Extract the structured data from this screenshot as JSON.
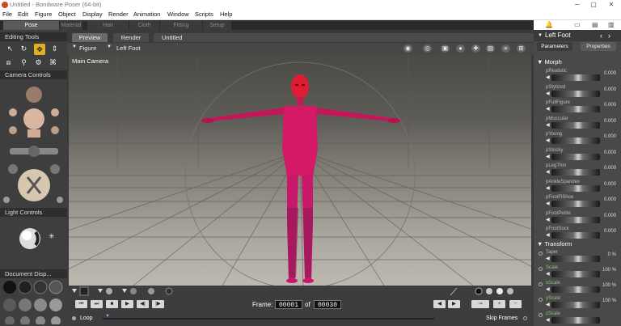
{
  "window": {
    "title": "Untitled - Bondware Poser (64-bit)",
    "buttons": [
      "─",
      "▢",
      "✕"
    ]
  },
  "menu": [
    "File",
    "Edit",
    "Figure",
    "Object",
    "Display",
    "Render",
    "Animation",
    "Window",
    "Scripts",
    "Help"
  ],
  "rooms": [
    "Pose",
    "Material",
    "Hair",
    "Cloth",
    "Fitting",
    "Setup"
  ],
  "rooms_active": "Pose",
  "left_panel": {
    "editing_tools": "Editing Tools",
    "camera_controls": "Camera Controls",
    "light_controls": "Light Controls",
    "document_display": "Document Disp..."
  },
  "view_tabs": [
    "Preview",
    "Render"
  ],
  "doc_title": "Untitled",
  "docbar": {
    "figure": "Figure",
    "part": "Left Foot"
  },
  "viewport": {
    "camera": "Main Camera"
  },
  "bottom": {
    "frame_label": "Frame:",
    "frame_current": "00001",
    "of_label": "of",
    "frame_total": "00030",
    "loop": "Loop",
    "skip_frames": "Skip Frames"
  },
  "transport": [
    "⏮",
    "⏭",
    "■",
    "▶",
    "◀|",
    "|▶"
  ],
  "right_panel": {
    "title": "Left Foot",
    "tabs": [
      "Parameters",
      "Properties"
    ],
    "morph_title": "Morph",
    "morph_params": [
      {
        "name": "pRealistic",
        "value": "0.000"
      },
      {
        "name": "pStylized",
        "value": "0.000"
      },
      {
        "name": "pFullFigure",
        "value": "0.000"
      },
      {
        "name": "pMuscular",
        "value": "0.000"
      },
      {
        "name": "pYoung",
        "value": "0.000"
      },
      {
        "name": "pStocky",
        "value": "0.000"
      },
      {
        "name": "pLegThin",
        "value": "0.000"
      },
      {
        "name": "pAnkleSpandex",
        "value": "0.000"
      },
      {
        "name": "pFootFlShoe",
        "value": "0.000"
      },
      {
        "name": "pFootPetite",
        "value": "0.000"
      },
      {
        "name": "pFootSock",
        "value": "0.000"
      }
    ],
    "transform_title": "Transform",
    "transform_params": [
      {
        "name": "Taper",
        "value": "0 %",
        "green": false
      },
      {
        "name": "Scale",
        "value": "100 %",
        "green": true
      },
      {
        "name": "xScale",
        "value": "100 %",
        "green": true
      },
      {
        "name": "yScale",
        "value": "100 %",
        "green": true
      },
      {
        "name": "zScale",
        "value": "",
        "green": true
      }
    ]
  },
  "colors": {
    "figure": "#d8206a",
    "figure_shadow": "#b0154e",
    "head": "#e81a3a",
    "accent_tool": "#e0b020"
  }
}
